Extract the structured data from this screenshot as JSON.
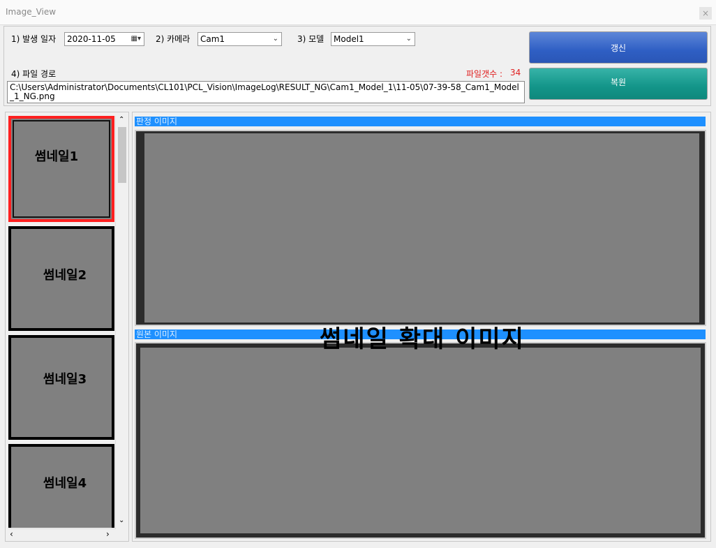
{
  "window": {
    "title": "Image_View",
    "close_label": "×"
  },
  "controls": {
    "date_label": "1) 발생 일자",
    "date_value": "2020-11-05",
    "camera_label": "2) 카메라",
    "camera_value": "Cam1",
    "model_label": "3) 모델",
    "model_value": "Model1",
    "path_label": "4) 파일 경로",
    "file_count_label": "파일갯수 :",
    "file_count_value": "34",
    "file_path": "C:\\Users\\Administrator\\Documents\\CL101\\PCL_Vision\\ImageLog\\RESULT_NG\\Cam1_Model_1\\11-05\\07-39-58_Cam1_Model_1_NG.png",
    "refresh_label": "갱신",
    "restore_label": "복원"
  },
  "thumbnails": [
    "썸네일1",
    "썸네일2",
    "썸네일3",
    "썸네일4"
  ],
  "viewer": {
    "judged_label": "판정 이미지",
    "original_label": "원본 이미지",
    "overlay_text": "썸네일 확대 이미지"
  },
  "colors": {
    "selected_border": "#ff2020",
    "header_bar": "#1e90ff",
    "refresh": "#2f5fc4",
    "restore": "#139589",
    "file_count": "#e02020"
  }
}
